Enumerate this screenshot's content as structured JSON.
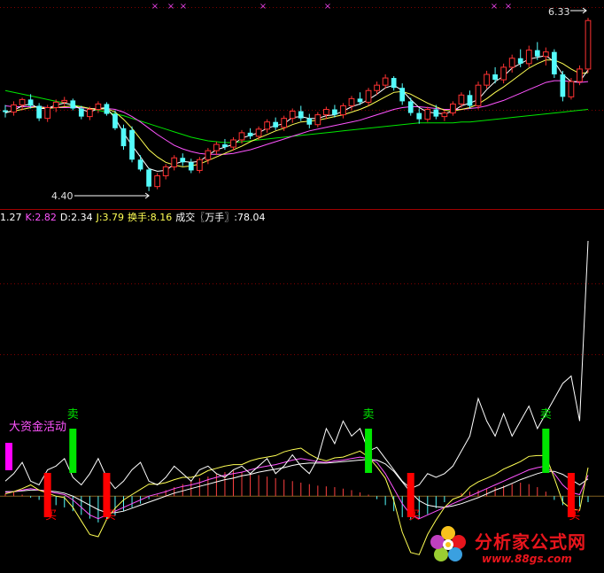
{
  "chart_data": [
    {
      "type": "candlestick",
      "title": "",
      "price_labels": {
        "high": "6.33",
        "low": "4.40"
      },
      "colors": {
        "up": "#ff3232",
        "down": "#54fcfc",
        "ma_white": "#ffffff",
        "ma_yellow": "#ffff54",
        "ma_magenta": "#ff54ff",
        "ma_green": "#00e600"
      },
      "markers": {
        "symbol": "×",
        "color": "#e040e0",
        "count": 10
      },
      "ylim": [
        4.2,
        6.45
      ],
      "candles": [
        [
          5.3,
          5.36,
          5.22,
          5.28
        ],
        [
          5.28,
          5.4,
          5.24,
          5.36
        ],
        [
          5.36,
          5.44,
          5.3,
          5.42
        ],
        [
          5.42,
          5.48,
          5.32,
          5.35
        ],
        [
          5.35,
          5.38,
          5.18,
          5.21
        ],
        [
          5.21,
          5.36,
          5.17,
          5.33
        ],
        [
          5.33,
          5.42,
          5.28,
          5.39
        ],
        [
          5.39,
          5.45,
          5.34,
          5.41
        ],
        [
          5.41,
          5.43,
          5.3,
          5.32
        ],
        [
          5.32,
          5.35,
          5.2,
          5.23
        ],
        [
          5.23,
          5.34,
          5.19,
          5.31
        ],
        [
          5.31,
          5.4,
          5.27,
          5.37
        ],
        [
          5.37,
          5.39,
          5.24,
          5.26
        ],
        [
          5.26,
          5.3,
          5.08,
          5.1
        ],
        [
          5.1,
          5.14,
          4.86,
          4.9
        ],
        [
          5.08,
          5.12,
          4.72,
          4.75
        ],
        [
          4.75,
          4.8,
          4.62,
          4.64
        ],
        [
          4.64,
          4.66,
          4.4,
          4.45
        ],
        [
          4.45,
          4.6,
          4.42,
          4.57
        ],
        [
          4.57,
          4.7,
          4.53,
          4.67
        ],
        [
          4.67,
          4.8,
          4.63,
          4.77
        ],
        [
          4.77,
          4.82,
          4.68,
          4.72
        ],
        [
          4.72,
          4.76,
          4.6,
          4.63
        ],
        [
          4.63,
          4.78,
          4.6,
          4.75
        ],
        [
          4.75,
          4.88,
          4.7,
          4.85
        ],
        [
          4.85,
          4.95,
          4.8,
          4.92
        ],
        [
          4.92,
          4.98,
          4.86,
          4.89
        ],
        [
          4.89,
          5.0,
          4.85,
          4.97
        ],
        [
          4.97,
          5.08,
          4.93,
          5.05
        ],
        [
          5.05,
          5.1,
          4.98,
          5.01
        ],
        [
          5.01,
          5.12,
          4.97,
          5.09
        ],
        [
          5.09,
          5.2,
          5.05,
          5.17
        ],
        [
          5.17,
          5.22,
          5.08,
          5.11
        ],
        [
          5.11,
          5.24,
          5.07,
          5.21
        ],
        [
          5.21,
          5.32,
          5.16,
          5.29
        ],
        [
          5.29,
          5.35,
          5.18,
          5.21
        ],
        [
          5.21,
          5.26,
          5.1,
          5.14
        ],
        [
          5.14,
          5.28,
          5.11,
          5.25
        ],
        [
          5.25,
          5.34,
          5.2,
          5.31
        ],
        [
          5.31,
          5.36,
          5.22,
          5.25
        ],
        [
          5.25,
          5.38,
          5.21,
          5.35
        ],
        [
          5.35,
          5.46,
          5.3,
          5.43
        ],
        [
          5.43,
          5.5,
          5.36,
          5.39
        ],
        [
          5.39,
          5.55,
          5.35,
          5.52
        ],
        [
          5.52,
          5.62,
          5.47,
          5.58
        ],
        [
          5.58,
          5.7,
          5.54,
          5.66
        ],
        [
          5.66,
          5.68,
          5.52,
          5.55
        ],
        [
          5.55,
          5.6,
          5.36,
          5.4
        ],
        [
          5.4,
          5.44,
          5.24,
          5.27
        ],
        [
          5.27,
          5.32,
          5.15,
          5.2
        ],
        [
          5.2,
          5.34,
          5.17,
          5.31
        ],
        [
          5.31,
          5.36,
          5.2,
          5.23
        ],
        [
          5.23,
          5.3,
          5.18,
          5.27
        ],
        [
          5.27,
          5.4,
          5.24,
          5.37
        ],
        [
          5.37,
          5.5,
          5.33,
          5.47
        ],
        [
          5.47,
          5.52,
          5.32,
          5.35
        ],
        [
          5.35,
          5.62,
          5.31,
          5.58
        ],
        [
          5.58,
          5.74,
          5.54,
          5.7
        ],
        [
          5.7,
          5.78,
          5.6,
          5.64
        ],
        [
          5.64,
          5.82,
          5.6,
          5.78
        ],
        [
          5.78,
          5.92,
          5.72,
          5.88
        ],
        [
          5.88,
          5.98,
          5.78,
          5.82
        ],
        [
          5.82,
          6.02,
          5.78,
          5.97
        ],
        [
          5.97,
          6.06,
          5.86,
          5.9
        ],
        [
          5.9,
          6.0,
          5.8,
          5.95
        ],
        [
          5.95,
          5.98,
          5.66,
          5.7
        ],
        [
          5.7,
          5.74,
          5.4,
          5.45
        ],
        [
          5.45,
          5.66,
          5.42,
          5.62
        ],
        [
          5.62,
          5.8,
          5.58,
          5.76
        ],
        [
          5.76,
          6.33,
          5.72,
          6.3
        ]
      ],
      "ma_white": [
        5.27,
        5.3,
        5.35,
        5.37,
        5.32,
        5.32,
        5.36,
        5.38,
        5.36,
        5.31,
        5.28,
        5.32,
        5.33,
        5.21,
        5.05,
        4.91,
        4.78,
        4.65,
        4.62,
        4.63,
        4.7,
        4.73,
        4.72,
        4.73,
        4.8,
        4.86,
        4.89,
        4.92,
        4.99,
        5.02,
        5.05,
        5.1,
        5.13,
        5.15,
        5.22,
        5.23,
        5.21,
        5.21,
        5.24,
        5.25,
        5.29,
        5.34,
        5.37,
        5.42,
        5.48,
        5.55,
        5.58,
        5.52,
        5.42,
        5.33,
        5.28,
        5.27,
        5.26,
        5.29,
        5.35,
        5.38,
        5.42,
        5.53,
        5.62,
        5.68,
        5.77,
        5.82,
        5.87,
        5.89,
        5.91,
        5.84,
        5.7,
        5.62,
        5.62,
        5.75
      ],
      "ma_yellow": [
        5.28,
        5.29,
        5.31,
        5.33,
        5.34,
        5.32,
        5.33,
        5.34,
        5.35,
        5.34,
        5.32,
        5.31,
        5.32,
        5.28,
        5.2,
        5.1,
        4.98,
        4.86,
        4.78,
        4.72,
        4.69,
        4.67,
        4.68,
        4.7,
        4.74,
        4.78,
        4.82,
        4.86,
        4.9,
        4.95,
        4.99,
        5.03,
        5.07,
        5.1,
        5.14,
        5.17,
        5.18,
        5.19,
        5.21,
        5.23,
        5.25,
        5.28,
        5.31,
        5.35,
        5.4,
        5.45,
        5.5,
        5.51,
        5.48,
        5.43,
        5.38,
        5.34,
        5.3,
        5.29,
        5.31,
        5.33,
        5.37,
        5.43,
        5.5,
        5.56,
        5.63,
        5.7,
        5.77,
        5.82,
        5.86,
        5.86,
        5.82,
        5.76,
        5.71,
        5.72
      ],
      "ma_magenta": [
        5.35,
        5.34,
        5.34,
        5.34,
        5.34,
        5.33,
        5.33,
        5.33,
        5.33,
        5.33,
        5.32,
        5.32,
        5.32,
        5.31,
        5.28,
        5.23,
        5.17,
        5.1,
        5.03,
        4.97,
        4.91,
        4.87,
        4.84,
        4.82,
        4.81,
        4.81,
        4.81,
        4.82,
        4.84,
        4.86,
        4.89,
        4.92,
        4.95,
        4.98,
        5.01,
        5.04,
        5.07,
        5.09,
        5.11,
        5.13,
        5.15,
        5.17,
        5.19,
        5.22,
        5.25,
        5.28,
        5.31,
        5.33,
        5.34,
        5.34,
        5.33,
        5.32,
        5.31,
        5.31,
        5.31,
        5.32,
        5.33,
        5.35,
        5.38,
        5.41,
        5.45,
        5.49,
        5.53,
        5.57,
        5.61,
        5.63,
        5.63,
        5.62,
        5.61,
        5.62
      ],
      "ma_green": [
        5.52,
        5.5,
        5.48,
        5.46,
        5.44,
        5.42,
        5.4,
        5.38,
        5.36,
        5.34,
        5.32,
        5.3,
        5.28,
        5.26,
        5.24,
        5.21,
        5.18,
        5.15,
        5.12,
        5.09,
        5.06,
        5.03,
        5.0,
        4.98,
        4.96,
        4.95,
        4.94,
        4.94,
        4.95,
        4.96,
        4.97,
        4.98,
        4.99,
        5.0,
        5.01,
        5.02,
        5.03,
        5.04,
        5.05,
        5.06,
        5.07,
        5.08,
        5.09,
        5.1,
        5.11,
        5.12,
        5.13,
        5.14,
        5.15,
        5.16,
        5.16,
        5.16,
        5.16,
        5.16,
        5.17,
        5.17,
        5.18,
        5.19,
        5.2,
        5.21,
        5.22,
        5.23,
        5.24,
        5.25,
        5.26,
        5.27,
        5.28,
        5.29,
        5.3,
        5.31
      ]
    },
    {
      "type": "line",
      "title": "",
      "indicators": [
        {
          "text": "1.27",
          "color": "#ffffff"
        },
        {
          "text": "K:2.82",
          "color": "#ff54ff"
        },
        {
          "text": "D:2.34",
          "color": "#ffffff"
        },
        {
          "text": "J:3.79",
          "color": "#ffff54"
        },
        {
          "text": "换手:8.16",
          "color": "#ffff54"
        },
        {
          "text": "成交〖万手〗:78.04",
          "color": "#ffffff"
        }
      ],
      "annotations": {
        "fund_label": "大资金活动",
        "sell_label": "卖",
        "buy_label": "买",
        "sell_positions": [
          8,
          43,
          64
        ],
        "buy_positions": [
          5,
          12,
          48,
          67
        ],
        "fund_positions": [
          1
        ]
      },
      "colors": {
        "sell": "#00e600",
        "buy": "#ff0000",
        "fund": "#ff00ff",
        "fund_text": "#ff54ff"
      },
      "ylim": [
        -10,
        36
      ],
      "turnover": [
        2.0,
        3.0,
        4.5,
        2.0,
        1.5,
        3.5,
        4.0,
        5.0,
        2.5,
        1.5,
        3.0,
        5.0,
        2.5,
        1.0,
        2.0,
        3.5,
        4.5,
        2.0,
        1.5,
        2.5,
        4.0,
        3.0,
        2.0,
        3.5,
        4.0,
        3.0,
        2.5,
        3.5,
        4.0,
        3.0,
        4.0,
        5.0,
        3.0,
        4.0,
        5.5,
        4.0,
        3.0,
        5.0,
        9.0,
        7.0,
        10.0,
        8.0,
        9.0,
        6.0,
        6.5,
        5.0,
        3.5,
        2.0,
        1.0,
        1.5,
        3.0,
        2.5,
        3.0,
        4.0,
        6.0,
        8.0,
        13.0,
        10.0,
        8.0,
        11.0,
        8.0,
        10.0,
        12.0,
        9.0,
        11.0,
        13.0,
        15.0,
        16.0,
        10.0,
        34.0
      ],
      "k_line": [
        0.5,
        0.6,
        0.8,
        1.0,
        0.8,
        0.6,
        0.4,
        0.2,
        -0.5,
        -1.5,
        -2.5,
        -3.0,
        -2.5,
        -2.0,
        -1.5,
        -1.0,
        -0.5,
        0.0,
        0.3,
        0.6,
        1.0,
        1.3,
        1.5,
        1.8,
        2.2,
        2.5,
        2.8,
        3.0,
        3.2,
        3.5,
        3.8,
        4.0,
        4.2,
        4.5,
        4.8,
        5.0,
        4.8,
        4.6,
        4.5,
        4.7,
        4.8,
        5.0,
        5.2,
        5.0,
        4.5,
        3.0,
        1.0,
        -1.0,
        -2.5,
        -3.0,
        -2.5,
        -2.0,
        -1.5,
        -1.0,
        -0.5,
        0.0,
        0.5,
        1.0,
        1.5,
        2.0,
        2.5,
        3.0,
        3.5,
        3.8,
        4.0,
        3.0,
        1.5,
        0.5,
        0.2,
        2.8
      ],
      "d_line": [
        0.6,
        0.6,
        0.7,
        0.8,
        0.8,
        0.7,
        0.6,
        0.4,
        0.0,
        -0.6,
        -1.2,
        -1.8,
        -2.2,
        -2.2,
        -2.0,
        -1.6,
        -1.2,
        -0.8,
        -0.4,
        0.0,
        0.4,
        0.7,
        1.0,
        1.3,
        1.6,
        1.9,
        2.2,
        2.4,
        2.7,
        2.9,
        3.2,
        3.4,
        3.6,
        3.8,
        4.1,
        4.3,
        4.4,
        4.4,
        4.4,
        4.5,
        4.6,
        4.7,
        4.8,
        4.9,
        4.8,
        4.3,
        3.3,
        1.9,
        0.5,
        -0.6,
        -1.2,
        -1.4,
        -1.5,
        -1.3,
        -1.0,
        -0.6,
        -0.2,
        0.3,
        0.8,
        1.2,
        1.7,
        2.2,
        2.6,
        3.0,
        3.3,
        3.3,
        2.9,
        2.2,
        1.5,
        2.3
      ],
      "j_line": [
        0.3,
        0.6,
        1.0,
        1.5,
        0.8,
        0.4,
        0.0,
        -0.2,
        -1.5,
        -3.3,
        -5.1,
        -5.4,
        -3.1,
        -1.6,
        -0.5,
        0.2,
        0.9,
        1.6,
        1.6,
        1.8,
        2.2,
        2.5,
        2.5,
        2.8,
        3.4,
        3.7,
        4.0,
        4.2,
        4.2,
        4.7,
        5.0,
        5.2,
        5.4,
        5.9,
        6.2,
        6.4,
        5.6,
        5.0,
        4.7,
        5.1,
        5.2,
        5.6,
        6.0,
        5.2,
        3.9,
        2.4,
        -0.6,
        -4.8,
        -7.5,
        -7.8,
        -5.1,
        -3.2,
        -1.5,
        -0.4,
        0.0,
        1.2,
        1.9,
        2.4,
        2.9,
        3.6,
        4.1,
        4.6,
        5.3,
        5.4,
        5.4,
        2.4,
        -0.8,
        -1.7,
        -1.9,
        3.8
      ],
      "macd_bars": [
        0.3,
        0.5,
        0.2,
        -0.2,
        -0.5,
        -0.8,
        -1.2,
        -1.5,
        -2.0,
        -2.5,
        -3.0,
        -3.5,
        -3.2,
        -2.6,
        -2.0,
        -1.5,
        -1.0,
        -0.4,
        0.2,
        0.8,
        1.2,
        1.6,
        2.0,
        2.4,
        2.6,
        3.0,
        3.2,
        3.4,
        3.2,
        3.0,
        2.8,
        2.6,
        2.4,
        2.2,
        2.0,
        1.8,
        1.6,
        1.4,
        1.3,
        1.2,
        1.0,
        0.8,
        0.5,
        0.2,
        -0.4,
        -1.2,
        -2.0,
        -2.8,
        -3.2,
        -3.0,
        -2.4,
        -1.6,
        -0.8,
        0.0,
        0.4,
        0.6,
        0.8,
        1.0,
        1.2,
        1.4,
        1.6,
        1.8,
        1.6,
        1.2,
        0.6,
        -0.5,
        -1.2,
        -1.6,
        -1.4,
        -0.8
      ]
    }
  ],
  "watermark": {
    "title": "分析家公式网",
    "url": "www.88gs.com"
  }
}
